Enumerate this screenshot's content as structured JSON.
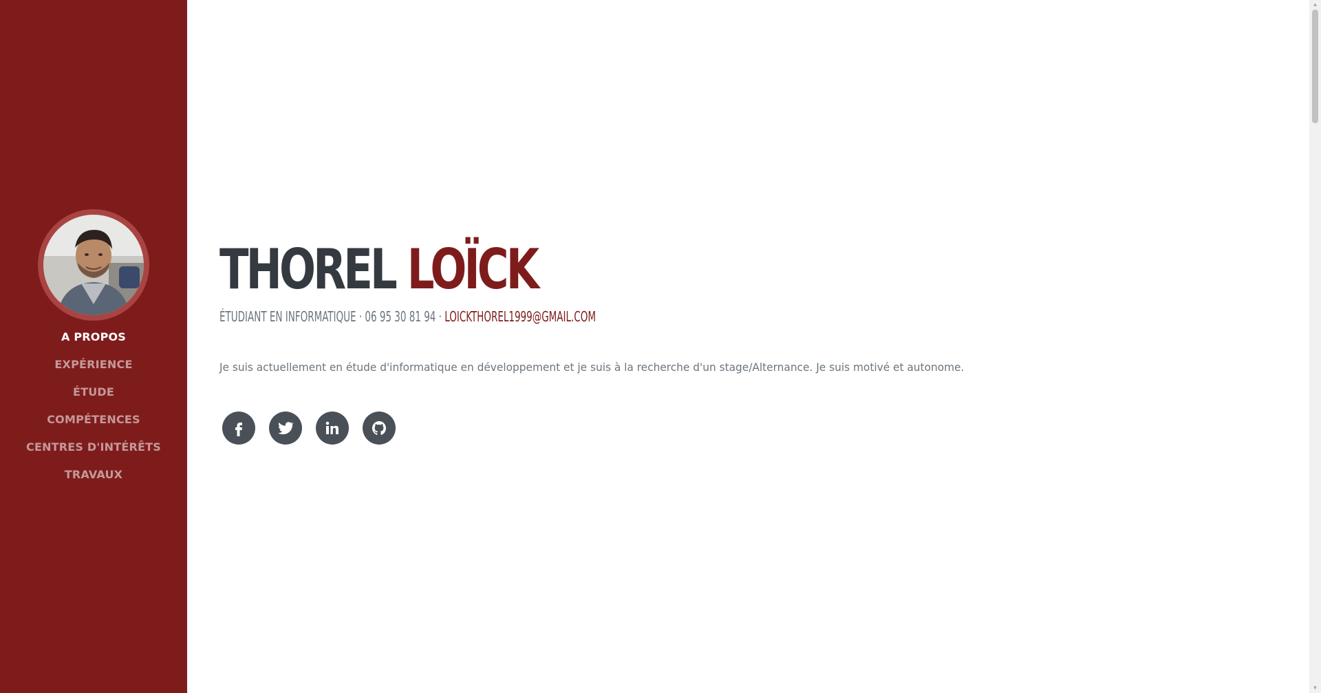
{
  "sidebar": {
    "avatar_alt": "Photo de profil",
    "nav": [
      {
        "label": "A PROPOS",
        "active": true
      },
      {
        "label": "EXPÉRIENCE"
      },
      {
        "label": "ÉTUDE"
      },
      {
        "label": "COMPÉTENCES"
      },
      {
        "label": "CENTRES D'INTÉRÊTS"
      },
      {
        "label": "TRAVAUX"
      }
    ]
  },
  "header": {
    "last_name": "THOREL",
    "first_name": "LOÏCK",
    "subtitle_role": "ÉTUDIANT EN INFORMATIQUE",
    "separator": " · ",
    "phone": "06 95 30 81 94",
    "email": "LOICKTHOREL1999@GMAIL.COM"
  },
  "about": {
    "text": "Je suis actuellement en étude d'informatique en développement et je suis à la recherche d'un stage/Alternance. Je suis motivé et autonome."
  },
  "social": [
    {
      "name": "facebook-icon"
    },
    {
      "name": "twitter-icon"
    },
    {
      "name": "linkedin-icon"
    },
    {
      "name": "github-icon"
    }
  ],
  "colors": {
    "primary": "#7e1c1c",
    "text_dark": "#343a40",
    "text_muted": "#6c757d",
    "social_bg": "#495057"
  }
}
